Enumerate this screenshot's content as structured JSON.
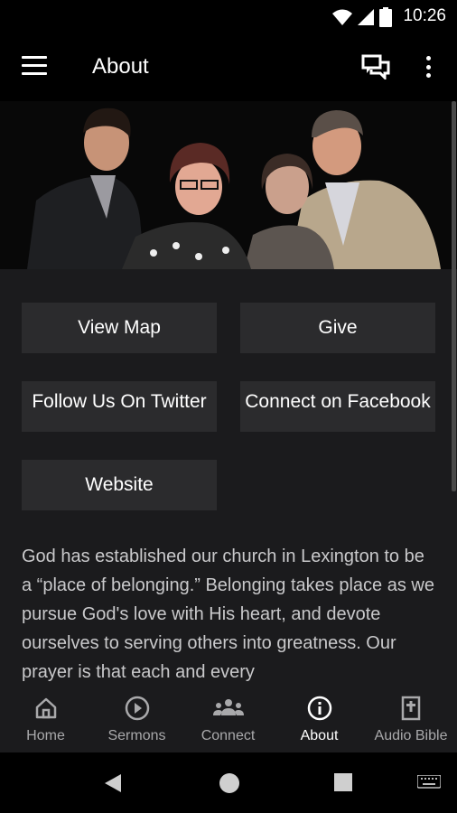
{
  "status_bar": {
    "time": "10:26",
    "icons": [
      "wifi-icon",
      "signal-icon",
      "battery-icon"
    ]
  },
  "app_bar": {
    "title": "About",
    "icons": [
      "menu-icon",
      "chat-icon",
      "more-vert-icon"
    ]
  },
  "buttons": {
    "view_map": "View Map",
    "give": "Give",
    "follow_twitter": "Follow Us On Twitter",
    "connect_facebook": "Connect on Facebook",
    "website": "Website"
  },
  "about_text": "God has established our church in Lexington to be a “place of belonging.” Belonging takes place as we pursue God's love with His heart, and devote ourselves to serving others into greatness. Our prayer is that each and every",
  "bottom_nav": {
    "items": [
      {
        "label": "Home",
        "icon": "home-icon"
      },
      {
        "label": "Sermons",
        "icon": "play-circle-icon"
      },
      {
        "label": "Connect",
        "icon": "group-icon"
      },
      {
        "label": "About",
        "icon": "info-icon",
        "active": true
      },
      {
        "label": "Audio Bible",
        "icon": "bible-icon"
      }
    ]
  },
  "system_nav": [
    "back-icon",
    "home-circle-icon",
    "recents-icon",
    "keyboard-icon"
  ],
  "colors": {
    "background": "#1b1b1d",
    "button": "#2b2b2d",
    "text_muted": "#c9c9cb",
    "active": "#ffffff",
    "inactive": "#a9a9ab"
  }
}
